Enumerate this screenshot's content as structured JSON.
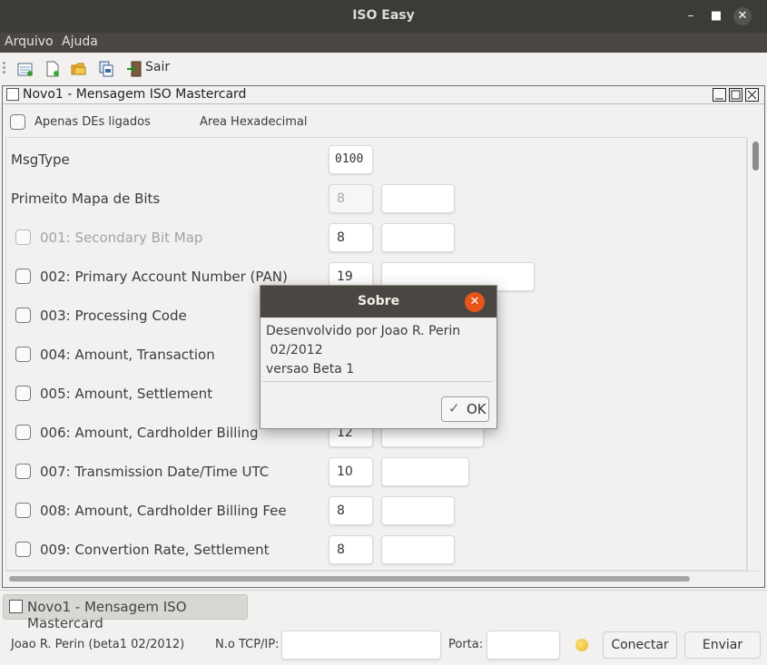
{
  "window": {
    "title": "ISO Easy",
    "minimize_icon": "minimize-icon",
    "maximize_icon": "maximize-icon",
    "close_icon": "close-icon"
  },
  "menu": {
    "items": [
      {
        "label": "Arquivo"
      },
      {
        "label": "Ajuda"
      }
    ]
  },
  "toolbar": {
    "icons": [
      "new-message-icon",
      "new-document-icon",
      "open-folder-icon",
      "copy-icon",
      "exit-icon"
    ],
    "exit_label": "Sair"
  },
  "internal_frame": {
    "title": "Novo1 - Mensagem ISO Mastercard",
    "options": {
      "apenas_label": "Apenas DEs ligados",
      "area_label": "Area Hexadecimal"
    },
    "rows": [
      {
        "label": "MsgType",
        "value": "0100"
      },
      {
        "label": "Primeito Mapa de Bits",
        "value": "8"
      },
      {
        "label": "001: Secondary Bit Map",
        "value": "8"
      },
      {
        "label": "002: Primary Account Number (PAN)",
        "value": "19"
      },
      {
        "label": "003: Processing Code",
        "value": ""
      },
      {
        "label": "004: Amount, Transaction",
        "value": ""
      },
      {
        "label": "005: Amount, Settlement",
        "value": ""
      },
      {
        "label": "006: Amount, Cardholder Billing",
        "value": "12"
      },
      {
        "label": "007: Transmission Date/Time UTC",
        "value": "10"
      },
      {
        "label": "008: Amount, Cardholder Billing Fee",
        "value": "8"
      },
      {
        "label": "009: Convertion Rate, Settlement",
        "value": "8"
      }
    ]
  },
  "taskbar": {
    "task_label": "Novo1 - Mensagem ISO Mastercard"
  },
  "statusbar": {
    "author": "Joao R. Perin (beta1 02/2012)",
    "tcp_label": "N.o TCP/IP:",
    "tcp_value": "",
    "port_label": "Porta:",
    "port_value": "",
    "connect_label": "Conectar",
    "send_label": "Enviar",
    "led_color": "#f0c030"
  },
  "dialog": {
    "title": "Sobre",
    "line1": "Desenvolvido por Joao R. Perin",
    "line2": " 02/2012",
    "line3": "versao Beta 1",
    "ok_label": "OK"
  }
}
